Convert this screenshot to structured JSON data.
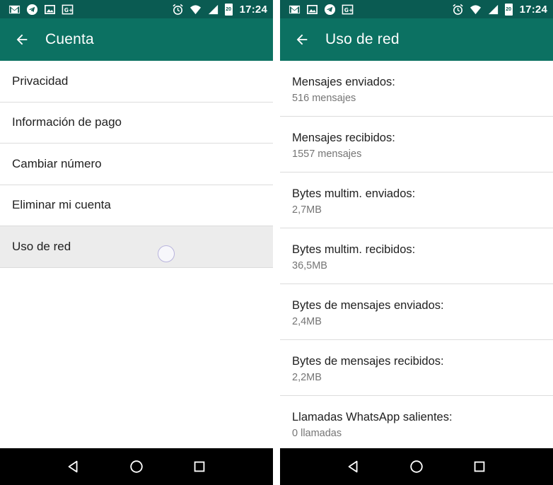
{
  "status_bar": {
    "time": "17:24",
    "battery_level": "20"
  },
  "left_screen": {
    "title": "Cuenta",
    "items": [
      {
        "label": "Privacidad"
      },
      {
        "label": "Información de pago"
      },
      {
        "label": "Cambiar número"
      },
      {
        "label": "Eliminar mi cuenta"
      },
      {
        "label": "Uso de red"
      }
    ]
  },
  "right_screen": {
    "title": "Uso de red",
    "stats": [
      {
        "label": "Mensajes enviados:",
        "value": "516 mensajes"
      },
      {
        "label": "Mensajes recibidos:",
        "value": "1557 mensajes"
      },
      {
        "label": "Bytes multim. enviados:",
        "value": "2,7MB"
      },
      {
        "label": "Bytes multim. recibidos:",
        "value": "36,5MB"
      },
      {
        "label": "Bytes de mensajes enviados:",
        "value": "2,4MB"
      },
      {
        "label": "Bytes de mensajes recibidos:",
        "value": "2,2MB"
      },
      {
        "label": "Llamadas WhatsApp salientes:",
        "value": "0 llamadas"
      }
    ]
  },
  "icons": {
    "status_left": [
      "gmail-icon",
      "telegram-icon",
      "gallery-icon",
      "google-plus-icon"
    ],
    "status_right": [
      "alarm-icon",
      "wifi-icon",
      "signal-icon",
      "battery-icon"
    ],
    "nav": [
      "back-triangle-icon",
      "home-circle-icon",
      "recents-square-icon"
    ]
  },
  "colors": {
    "status_bar": "#0a5b52",
    "toolbar": "#0c7162",
    "pressed_row": "#ececec",
    "nav_bar": "#000000"
  }
}
